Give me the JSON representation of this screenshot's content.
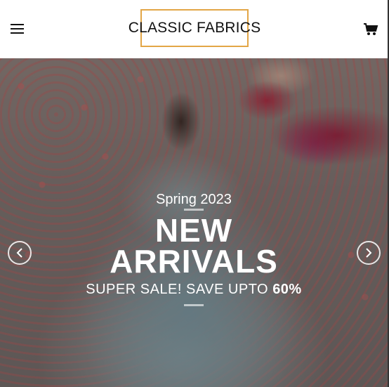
{
  "header": {
    "brand": "CLASSIC FABRICS",
    "menu_icon": "hamburger-icon",
    "cart_icon": "cart-icon",
    "brand_border_color": "#e3a646"
  },
  "hero": {
    "eyebrow": "Spring 2023",
    "title_line1": "NEW",
    "title_line2": "ARRIVALS",
    "subtitle_prefix": "SUPER SALE! SAVE UPTO",
    "subtitle_highlight": "60%",
    "prev_icon": "chevron-left-icon",
    "next_icon": "chevron-right-icon"
  }
}
